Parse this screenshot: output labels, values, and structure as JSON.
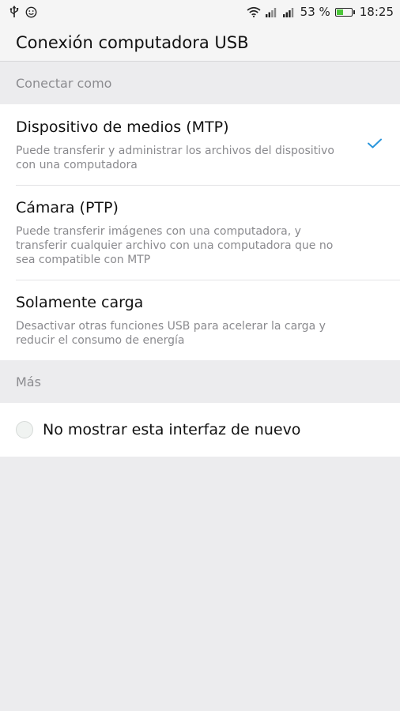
{
  "status_bar": {
    "battery_percent": "53 %",
    "battery_level": 0.53,
    "time": "18:25",
    "icons": [
      "usb-icon",
      "smiley-icon",
      "wifi-icon",
      "signal-icon",
      "signal-icon",
      "battery-icon"
    ]
  },
  "header": {
    "title": "Conexión computadora USB"
  },
  "connect_section": {
    "header": "Conectar como",
    "options": [
      {
        "title": "Dispositivo de medios (MTP)",
        "description": "Puede transferir y administrar los archivos del dispositivo con una computadora",
        "selected": true
      },
      {
        "title": "Cámara (PTP)",
        "description": "Puede transferir imágenes con una computadora, y transferir cualquier archivo con una computadora que no sea compatible con MTP",
        "selected": false
      },
      {
        "title": "Solamente carga",
        "description": "Desactivar otras funciones USB para acelerar la carga y reducir el consumo de energía",
        "selected": false
      }
    ]
  },
  "more_section": {
    "header": "Más",
    "checkbox_label": "No mostrar esta interfaz de nuevo",
    "checked": false
  },
  "colors": {
    "accent": "#2a96dc",
    "background": "#ececee",
    "battery_fill": "#4cc63a"
  }
}
